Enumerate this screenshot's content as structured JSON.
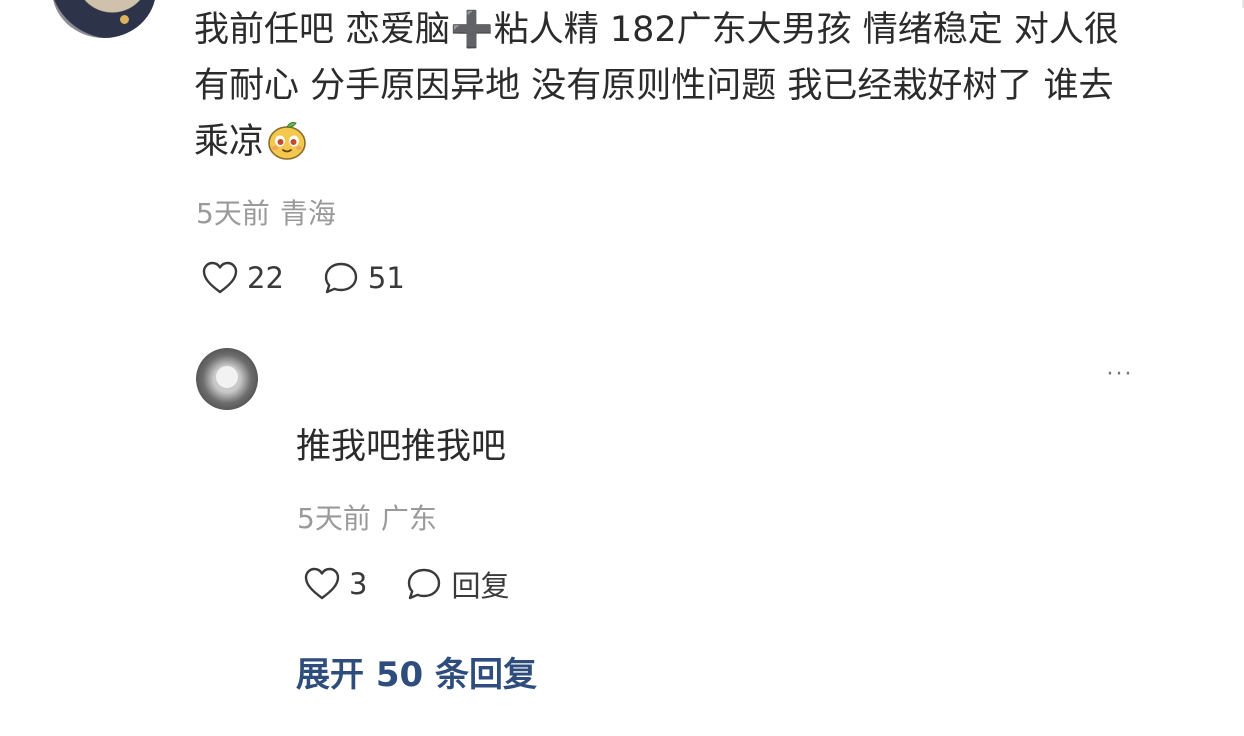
{
  "comment": {
    "text": "我前任吧 恋爱脑➕粘人精 182广东大男孩 情绪稳定 对人很有耐心 分手原因异地 没有原则性问题 我已经栽好树了 谁去乘凉",
    "emoji": "mango-face-emoji",
    "time": "5天前",
    "location": "青海",
    "likes": "22",
    "comments": "51"
  },
  "reply": {
    "text": "推我吧推我吧",
    "time": "5天前",
    "location": "广东",
    "likes": "3",
    "reply_label": "回复",
    "more_label": "···"
  },
  "expand_replies": "展开 50 条回复",
  "icons": {
    "like": "heart-icon",
    "comment": "speech-bubble-icon",
    "more": "more-icon"
  },
  "colors": {
    "link": "#2e4d7c",
    "meta": "#9a9a9a",
    "text": "#2b2b2b"
  }
}
